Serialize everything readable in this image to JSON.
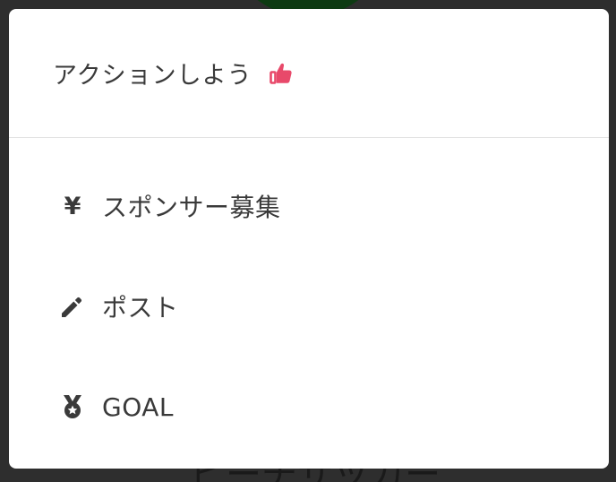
{
  "background": {
    "partial_text": "ビーチサッカー"
  },
  "sheet": {
    "header": {
      "title": "アクションしよう",
      "icon": "thumbs-up-icon",
      "icon_color": "#e8496a"
    },
    "items": [
      {
        "label": "スポンサー募集",
        "icon": "yen-icon"
      },
      {
        "label": "ポスト",
        "icon": "pencil-icon"
      },
      {
        "label": "GOAL",
        "icon": "medal-icon"
      }
    ]
  },
  "colors": {
    "overlay": "#2e2e2e",
    "sheet_bg": "#ffffff",
    "text": "#3a3a3a",
    "accent": "#e8496a",
    "divider": "#e2e2e2"
  }
}
